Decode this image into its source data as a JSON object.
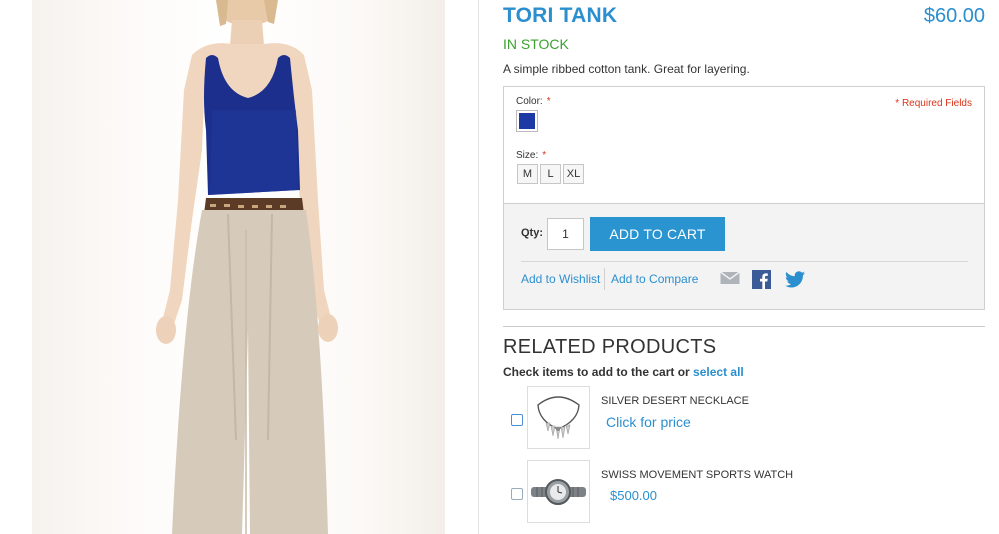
{
  "product": {
    "title": "TORI TANK",
    "price": "$60.00",
    "stock": "IN STOCK",
    "description": "A simple ribbed cotton tank. Great for layering.",
    "image_icon": "model-photo"
  },
  "options": {
    "color_label": "Color:",
    "size_label": "Size:",
    "required_star": "*",
    "required_fields": "* Required Fields",
    "color_swatch": "#1d39a4",
    "sizes": [
      "M",
      "L",
      "XL"
    ]
  },
  "cart": {
    "qty_label": "Qty:",
    "qty_value": "1",
    "add_button": "ADD TO CART",
    "wishlist_link": "Add to Wishlist",
    "compare_link": "Add to Compare",
    "share_icons": [
      "email-icon",
      "facebook-icon",
      "twitter-icon"
    ]
  },
  "related": {
    "title": "RELATED PRODUCTS",
    "note": "Check items to add to the cart or",
    "select_all": "select all",
    "items": [
      {
        "name": "SILVER DESERT NECKLACE",
        "price": "Click for price",
        "icon": "necklace-thumbnail"
      },
      {
        "name": "SWISS MOVEMENT SPORTS WATCH",
        "price": "$500.00",
        "icon": "watch-thumbnail"
      }
    ]
  },
  "colors": {
    "accent": "#2b8fcf",
    "button": "#2a94d1",
    "stock": "#3ca12f",
    "required": "#d9331a"
  }
}
